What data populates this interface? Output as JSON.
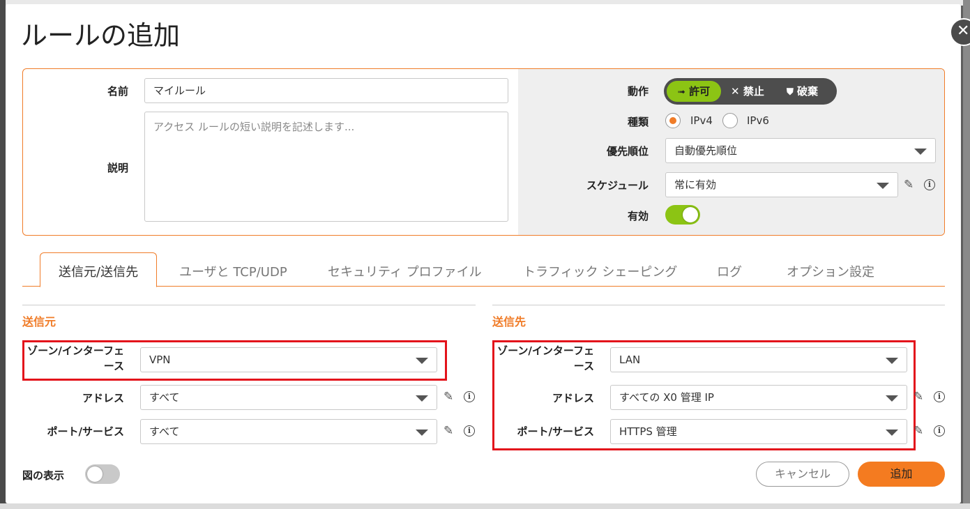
{
  "dialog": {
    "title": "ルールの追加"
  },
  "general": {
    "name_label": "名前",
    "name_value": "マイルール",
    "desc_label": "説明",
    "desc_placeholder": "アクセス ルールの短い説明を記述します...",
    "action_label": "動作",
    "action_options": [
      "許可",
      "禁止",
      "破棄"
    ],
    "action_selected": "許可",
    "type_label": "種類",
    "type_options": [
      "IPv4",
      "IPv6"
    ],
    "type_selected": "IPv4",
    "priority_label": "優先順位",
    "priority_value": "自動優先順位",
    "schedule_label": "スケジュール",
    "schedule_value": "常に有効",
    "enable_label": "有効",
    "enabled": true
  },
  "tabs": [
    "送信元/送信先",
    "ユーザと TCP/UDP",
    "セキュリティ プロファイル",
    "トラフィック シェーピング",
    "ログ",
    "オプション設定"
  ],
  "active_tab": "送信元/送信先",
  "source": {
    "heading": "送信元",
    "zone_label": "ゾーン/インターフェース",
    "zone_value": "VPN",
    "address_label": "アドレス",
    "address_value": "すべて",
    "port_label": "ポート/サービス",
    "port_value": "すべて"
  },
  "destination": {
    "heading": "送信先",
    "zone_label": "ゾーン/インターフェース",
    "zone_value": "LAN",
    "address_label": "アドレス",
    "address_value": "すべての X0 管理 IP",
    "port_label": "ポート/サービス",
    "port_value": "HTTPS 管理"
  },
  "footer": {
    "diagram_label": "図の表示",
    "diagram_on": false,
    "cancel_label": "キャンセル",
    "add_label": "追加"
  },
  "colors": {
    "accent": "#f07c28",
    "green": "#8cc414",
    "highlight": "#e3131b"
  },
  "icons": [
    "close-icon",
    "arrow-right-icon",
    "x-icon",
    "shield-icon",
    "pencil-icon",
    "info-icon",
    "chevron-down-icon"
  ]
}
